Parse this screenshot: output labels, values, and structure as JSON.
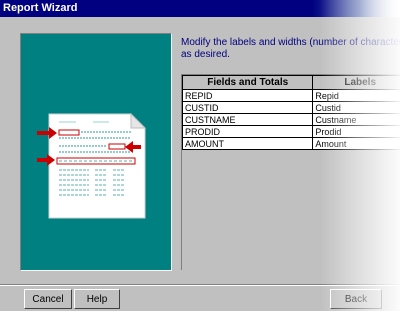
{
  "window": {
    "title": "Report Wizard"
  },
  "instructions": {
    "line1": "Modify the labels and widths (number of characters)",
    "line2": "as desired."
  },
  "grid": {
    "headers": [
      "Fields and Totals",
      "Labels"
    ],
    "rows": [
      {
        "field": "REPID",
        "label": "Repid"
      },
      {
        "field": "CUSTID",
        "label": "Custid"
      },
      {
        "field": "CUSTNAME",
        "label": "Custname"
      },
      {
        "field": "PRODID",
        "label": "Prodid"
      },
      {
        "field": "AMOUNT",
        "label": "Amount"
      }
    ]
  },
  "buttons": {
    "cancel": "Cancel",
    "help": "Help",
    "back": "Back"
  },
  "colors": {
    "panel": "#008080",
    "titlebar": "#000080",
    "arrows": "#cc0000",
    "text": "#000080"
  }
}
